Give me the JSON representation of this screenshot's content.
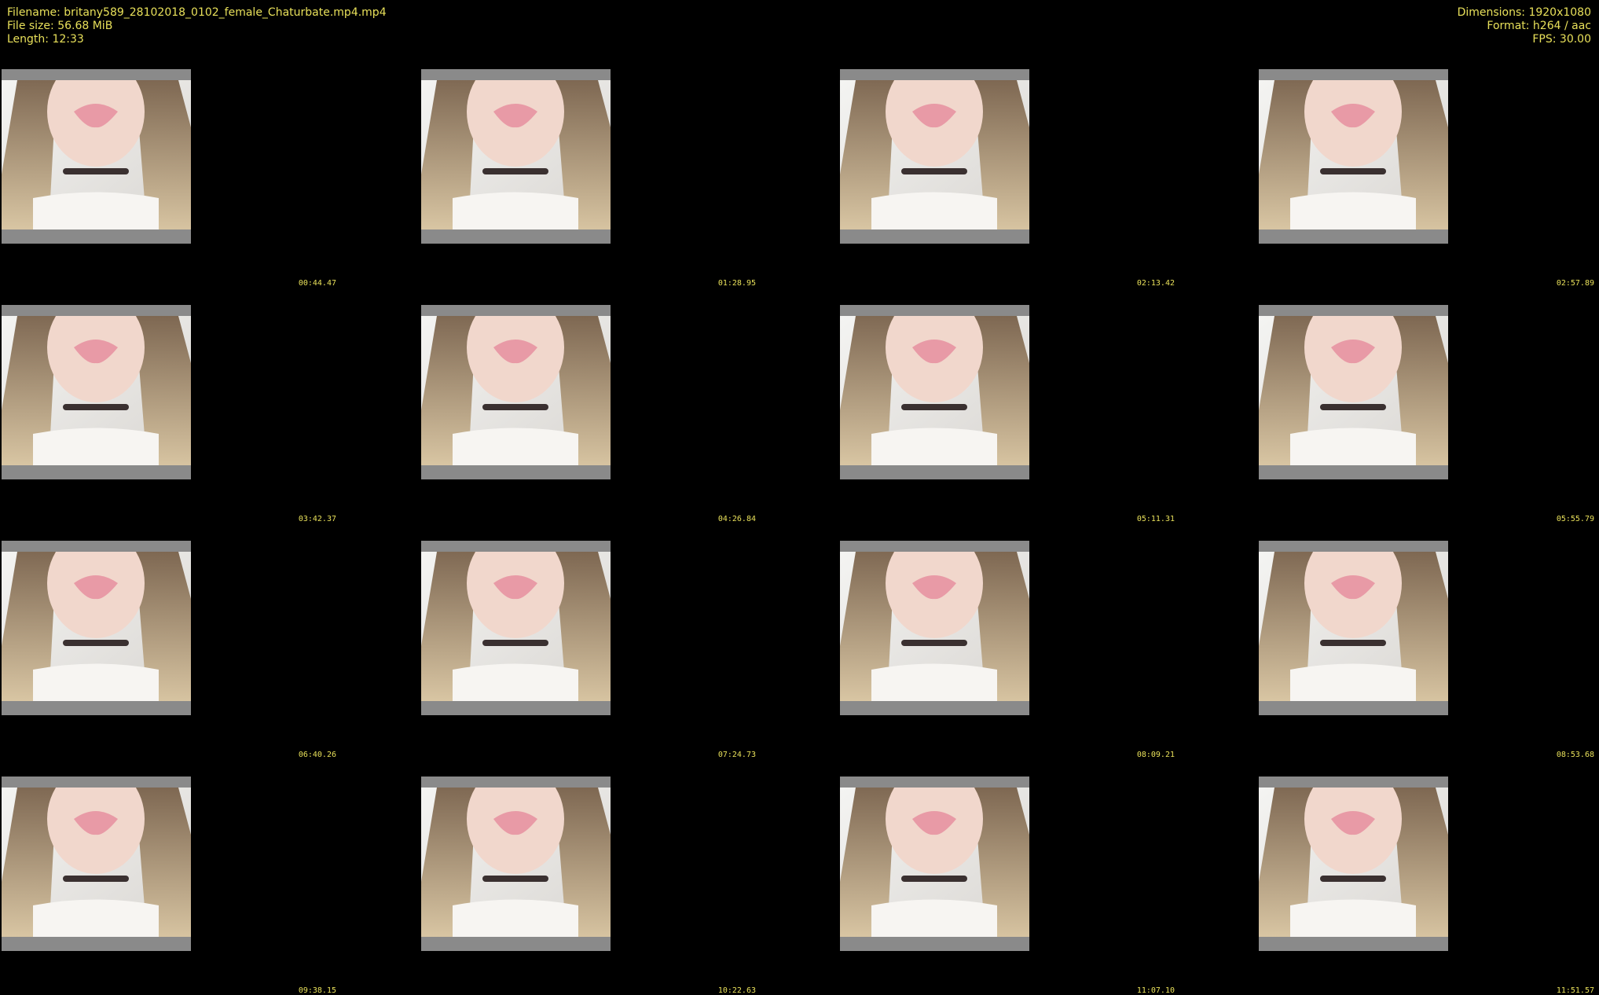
{
  "file_info": {
    "filename_line": "Filename: britany589_28102018_0102_female_Chaturbate.mp4.mp4",
    "filesize_line": "File size: 56.68 MiB",
    "length_line": "Length: 12:33"
  },
  "video_info": {
    "dimensions_line": "Dimensions: 1920x1080",
    "format_line": "Format: h264 / aac",
    "fps_line": "FPS: 30.00"
  },
  "colors": {
    "background": "#000000",
    "text": "#e8e05a",
    "letterbox": "#8a8a8a"
  },
  "thumbnails": [
    {
      "timestamp": "00:44.47"
    },
    {
      "timestamp": "01:28.95"
    },
    {
      "timestamp": "02:13.42"
    },
    {
      "timestamp": "02:57.89"
    },
    {
      "timestamp": "03:42.37"
    },
    {
      "timestamp": "04:26.84"
    },
    {
      "timestamp": "05:11.31"
    },
    {
      "timestamp": "05:55.79"
    },
    {
      "timestamp": "06:40.26"
    },
    {
      "timestamp": "07:24.73"
    },
    {
      "timestamp": "08:09.21"
    },
    {
      "timestamp": "08:53.68"
    },
    {
      "timestamp": "09:38.15"
    },
    {
      "timestamp": "10:22.63"
    },
    {
      "timestamp": "11:07.10"
    },
    {
      "timestamp": "11:51.57"
    }
  ]
}
